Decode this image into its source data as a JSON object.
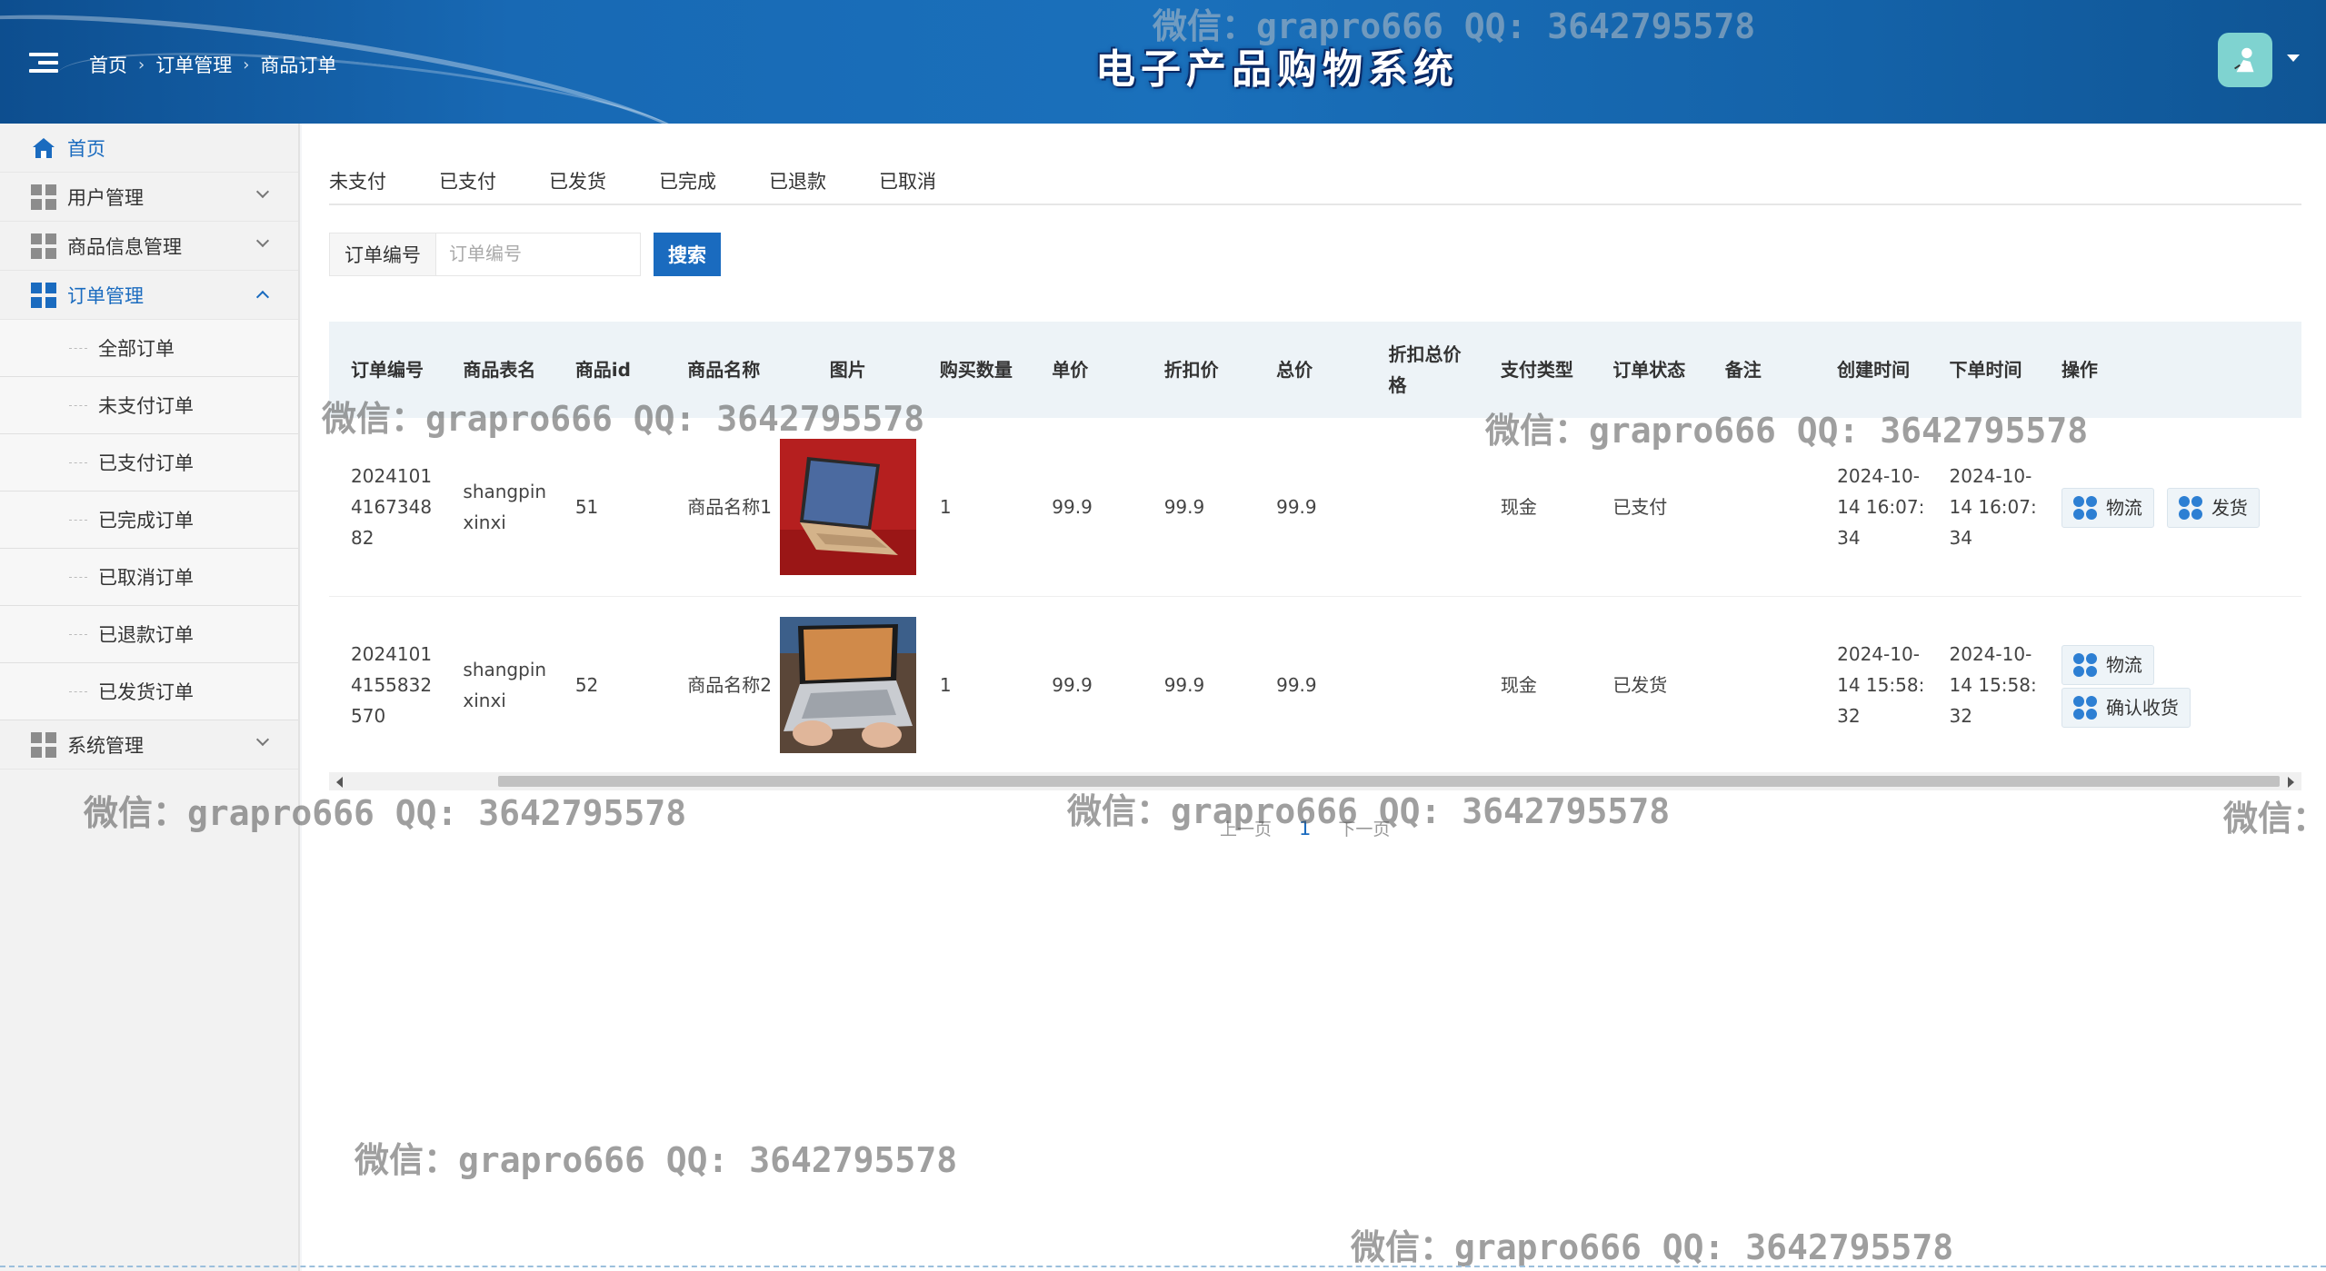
{
  "header": {
    "breadcrumb": [
      "首页",
      "订单管理",
      "商品订单"
    ],
    "title": "电子产品购物系统"
  },
  "sidebar": {
    "home": "首页",
    "user_mgmt": "用户管理",
    "product_mgmt": "商品信息管理",
    "order_mgmt": "订单管理",
    "order_subs": [
      "全部订单",
      "未支付订单",
      "已支付订单",
      "已完成订单",
      "已取消订单",
      "已退款订单",
      "已发货订单"
    ],
    "system_mgmt": "系统管理"
  },
  "tabs": [
    "未支付",
    "已支付",
    "已发货",
    "已完成",
    "已退款",
    "已取消"
  ],
  "search": {
    "label": "订单编号",
    "placeholder": "订单编号",
    "button": "搜索"
  },
  "table": {
    "headers": [
      "订单编号",
      "商品表名",
      "商品id",
      "商品名称",
      "图片",
      "购买数量",
      "单价",
      "折扣价",
      "总价",
      "折扣总价格",
      "支付类型",
      "订单状态",
      "备注",
      "创建时间",
      "下单时间",
      "操作"
    ],
    "rows": [
      {
        "order_no": "20241014167348 82",
        "table_name": "shangpinxinxi",
        "product_id": "51",
        "product_name": "商品名称1",
        "quantity": "1",
        "price": "99.9",
        "discount_price": "99.9",
        "total": "99.9",
        "discount_total": "",
        "pay_type": "现金",
        "status": "已支付",
        "remark": "",
        "created": "2024-10-14 16:07:34",
        "ordered": "2024-10-14 16:07:34",
        "btn1": "物流",
        "btn2": "发货"
      },
      {
        "order_no": "20241014155832 570",
        "table_name": "shangpinxinxi",
        "product_id": "52",
        "product_name": "商品名称2",
        "quantity": "1",
        "price": "99.9",
        "discount_price": "99.9",
        "total": "99.9",
        "discount_total": "",
        "pay_type": "现金",
        "status": "已发货",
        "remark": "",
        "created": "2024-10-14 15:58:32",
        "ordered": "2024-10-14 15:58:32",
        "btn1": "物流",
        "btn2": "确认收货"
      }
    ]
  },
  "pager": {
    "prev": "上一页",
    "current": "1",
    "next": "下一页"
  },
  "watermark": "微信：grapro666 QQ: 3642795578",
  "watermark_partial": "微信：",
  "colors": {
    "accent": "#1a6bbf",
    "header": "#1869b4"
  }
}
